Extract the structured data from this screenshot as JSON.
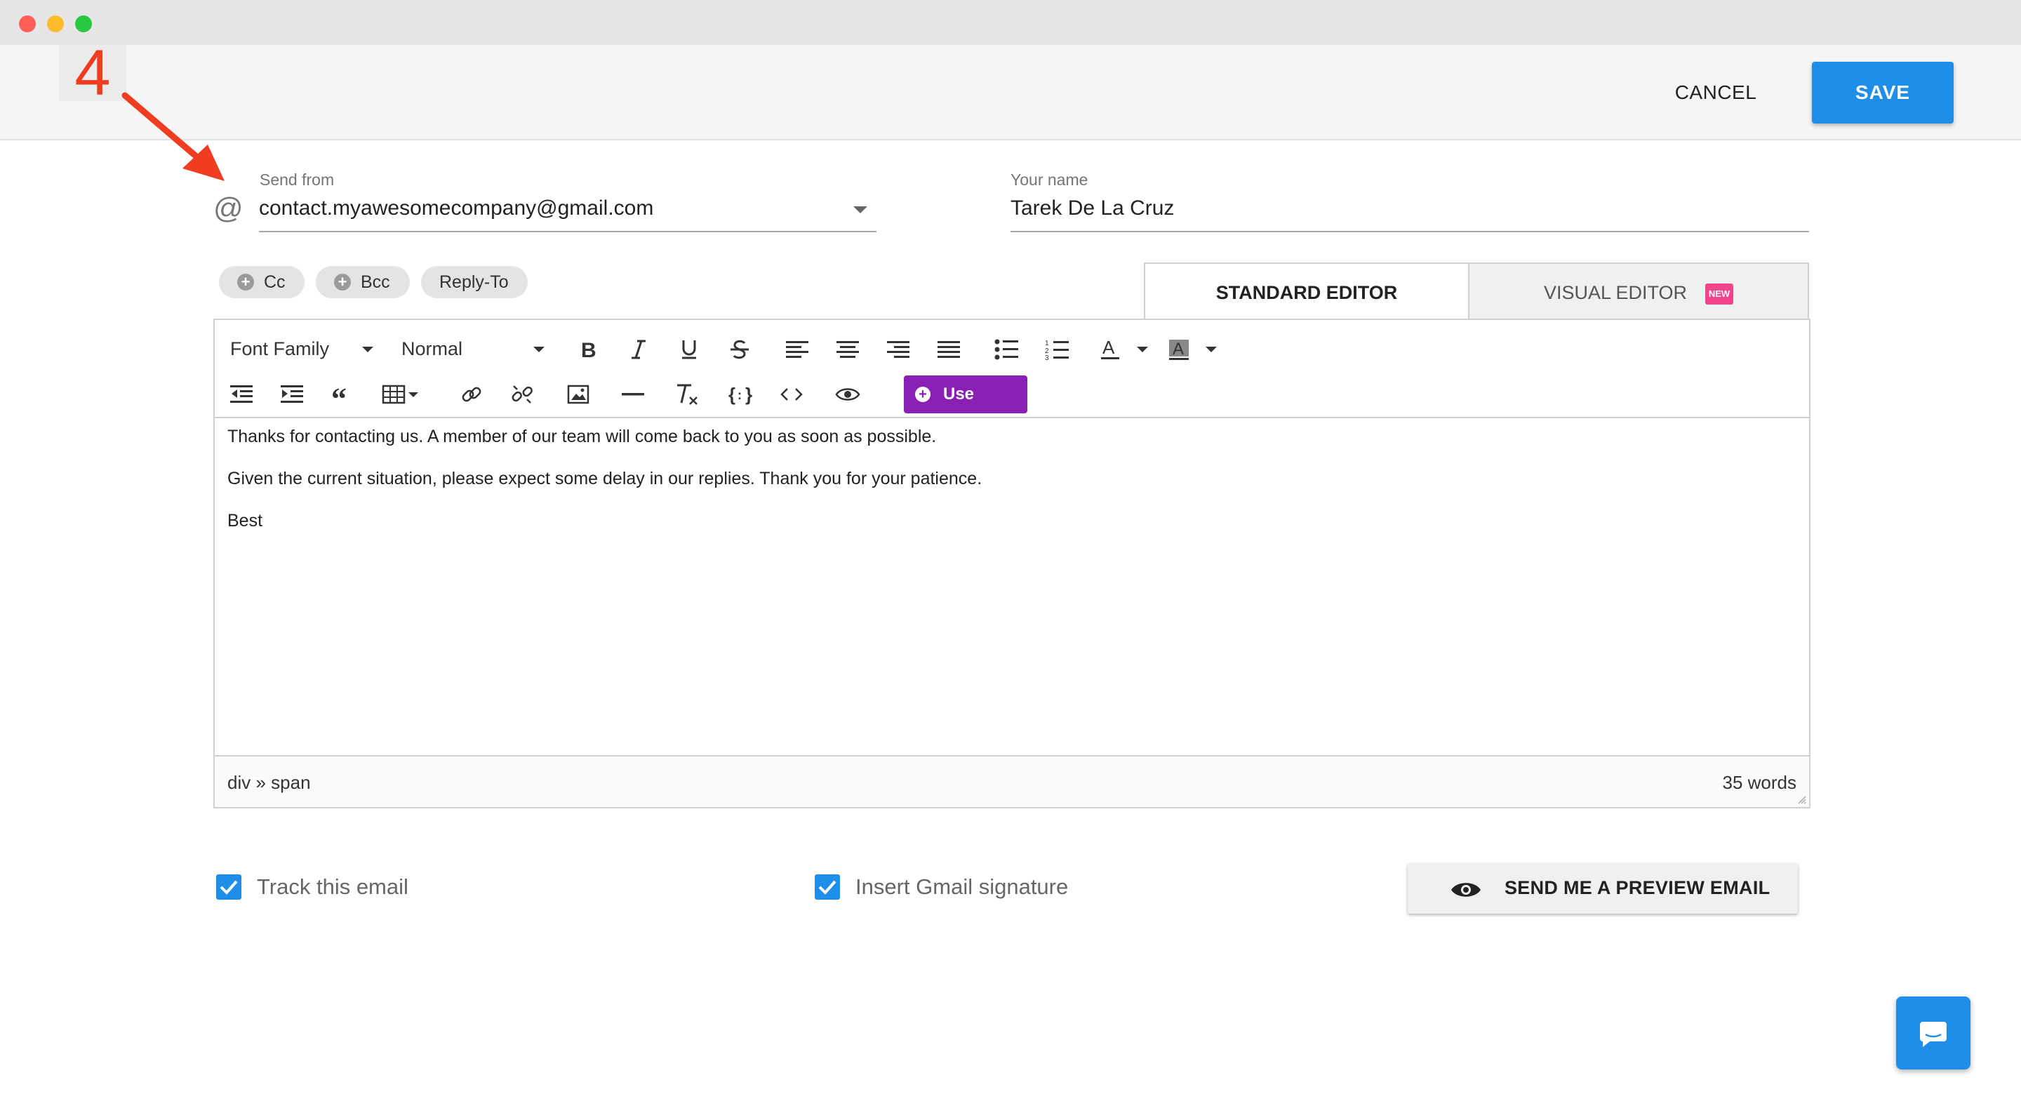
{
  "window": {
    "controls": [
      "close",
      "minimize",
      "maximize"
    ]
  },
  "annotation": {
    "step_number": "4"
  },
  "header": {
    "cancel_label": "CANCEL",
    "save_label": "SAVE"
  },
  "form": {
    "send_from": {
      "label": "Send from",
      "value": "contact.myawesomecompany@gmail.com",
      "icon": "at-icon"
    },
    "your_name": {
      "label": "Your name",
      "value": "Tarek De La Cruz"
    }
  },
  "chips": [
    {
      "label": "Cc",
      "has_plus": true
    },
    {
      "label": "Bcc",
      "has_plus": true
    },
    {
      "label": "Reply-To",
      "has_plus": false
    }
  ],
  "tabs": {
    "standard": "STANDARD EDITOR",
    "visual": "VISUAL EDITOR",
    "new_badge": "NEW",
    "active": "standard"
  },
  "toolbar": {
    "font_family": "Font Family",
    "font_size": "Normal",
    "use_template": "Use Template"
  },
  "editor_content": [
    "Thanks for contacting us. A member of our team will come back to you as soon as possible.",
    "Given the current situation, please expect some delay in our replies. Thank you for your patience.",
    "Best"
  ],
  "statusbar": {
    "path": "div » span",
    "word_count": "35 words"
  },
  "options": {
    "track_email": {
      "label": "Track this email",
      "checked": true
    },
    "gmail_signature": {
      "label": "Insert Gmail signature",
      "checked": true
    }
  },
  "preview_button": {
    "label": "SEND ME A PREVIEW EMAIL",
    "icon": "eye-icon"
  },
  "colors": {
    "primary": "#1e8ee8",
    "template_purple": "#8a1fb4",
    "badge_pink": "#f2468c",
    "annotation_red": "#f03c20"
  }
}
